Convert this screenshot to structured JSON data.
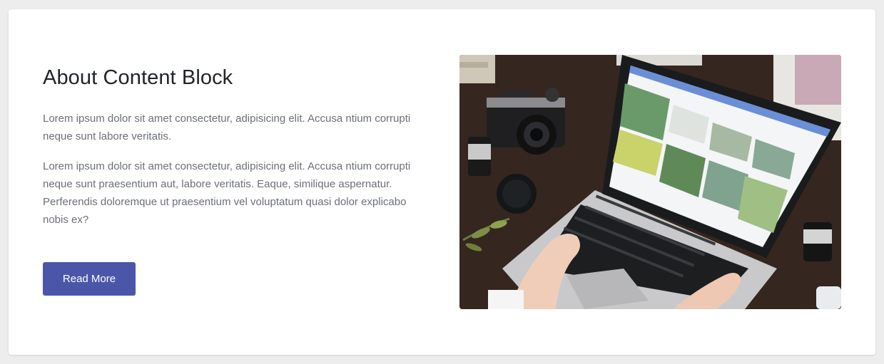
{
  "about": {
    "title": "About Content Block",
    "paragraph_1": "Lorem ipsum dolor sit amet consectetur, adipisicing elit. Accusa ntium corrupti neque sunt labore veritatis.",
    "paragraph_2": "Lorem ipsum dolor sit amet consectetur, adipisicing elit. Accusa ntium corrupti neque sunt praesentium aut, labore veritatis. Eaque, similique aspernatur. Perferendis doloremque ut praesentium vel voluptatum quasi dolor explicabo nobis ex?",
    "button_label": "Read More"
  },
  "colors": {
    "page_background": "#ededee",
    "card_background": "#ffffff",
    "heading": "#212529",
    "body_text": "#6c6f7a",
    "button": "#4c56a9"
  }
}
